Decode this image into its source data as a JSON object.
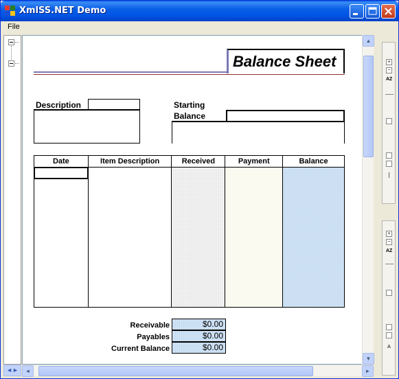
{
  "window": {
    "title": "XmlSS.NET Demo",
    "controls": [
      "minimize",
      "maximize",
      "close"
    ]
  },
  "menu": {
    "items": [
      "File"
    ]
  },
  "sheet": {
    "title": "Balance Sheet",
    "description_label": "Description",
    "starting_label_line1": "Starting",
    "starting_label_line2": "Balance",
    "columns": [
      "Date",
      "Item Description",
      "Received",
      "Payment",
      "Balance"
    ],
    "summary": [
      {
        "label": "Receivable",
        "value": "$0.00"
      },
      {
        "label": "Payables",
        "value": "$0.00"
      },
      {
        "label": "Current Balance",
        "value": "$0.00"
      }
    ]
  },
  "colors": {
    "title_bar": "#0055e5",
    "balance_fill": "#cfe2f5",
    "payment_fill": "#fbfaf0",
    "accent_line": "#7b78b4"
  }
}
